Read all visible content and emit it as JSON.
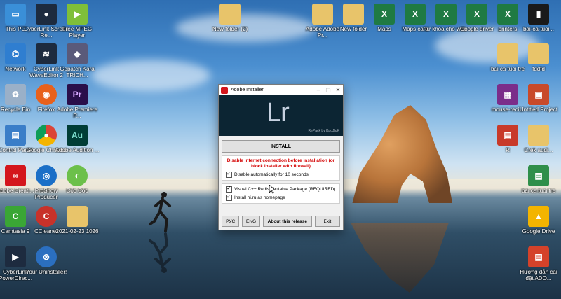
{
  "desktop_icons": [
    {
      "label": "This PC",
      "icon": "computer-icon",
      "color": "#3a8fd8"
    },
    {
      "label": "CyberLink Screen Re...",
      "icon": "screen-recorder-icon",
      "color": "#1d2b3f"
    },
    {
      "label": "Free MPEG Player",
      "icon": "media-player-icon",
      "color": "#7fbf3a"
    },
    {
      "label": "Network",
      "icon": "network-icon",
      "color": "#2f7ed0"
    },
    {
      "label": "CyberLink WaveEditor 2",
      "icon": "wave-editor-icon",
      "color": "#1d2b3f"
    },
    {
      "label": "Gepatch Kara TRICH...",
      "icon": "gepatch-icon",
      "color": "#5a5a7a"
    },
    {
      "label": "Recycle Bin",
      "icon": "recycle-bin-icon",
      "color": "#9ab0c8"
    },
    {
      "label": "Firefox",
      "icon": "firefox-icon",
      "color": "#e8611c"
    },
    {
      "label": "Adobe Premiere P...",
      "icon": "premiere-icon",
      "color": "#2a0f4a"
    },
    {
      "label": "Control Panel",
      "icon": "control-panel-icon",
      "color": "#3a7ec8"
    },
    {
      "label": "Google Chrome",
      "icon": "chrome-icon",
      "color": "#db4437"
    },
    {
      "label": "Adobe Audition ...",
      "icon": "audition-icon",
      "color": "#003d36"
    },
    {
      "label": "Adobe Creati...",
      "icon": "creative-cloud-icon",
      "color": "#d4161c"
    },
    {
      "label": "ProShow Producer",
      "icon": "proshow-icon",
      "color": "#1b6fc7"
    },
    {
      "label": "Cốc Cốc",
      "icon": "coccoc-icon",
      "color": "#6cc04a"
    },
    {
      "label": "Camtasia 9",
      "icon": "camtasia-icon",
      "color": "#3aa635"
    },
    {
      "label": "CCleaner",
      "icon": "ccleaner-icon",
      "color": "#c8322a"
    },
    {
      "label": "2021-02-23 1026",
      "icon": "folder-icon",
      "color": "#e8c46a"
    },
    {
      "label": "CyberLink PowerDirec...",
      "icon": "powerdirector-icon",
      "color": "#1d2b3f"
    },
    {
      "label": "Your Uninstaller!",
      "icon": "uninstaller-icon",
      "color": "#2b6fc0"
    },
    {
      "label": "New folder (2)",
      "icon": "folder-icon",
      "color": "#e8c46a"
    },
    {
      "label": "Adobe Adobe Pr...",
      "icon": "folder-icon",
      "color": "#e8c46a"
    },
    {
      "label": "New folder",
      "icon": "folder-icon",
      "color": "#e8c46a"
    },
    {
      "label": "Maps",
      "icon": "excel-icon",
      "color": "#1f7a43"
    },
    {
      "label": "Maps cafe",
      "icon": "excel-icon",
      "color": "#1f7a43"
    },
    {
      "label": "từ khóa cho web",
      "icon": "excel-icon",
      "color": "#1f7a43"
    },
    {
      "label": "Google driver",
      "icon": "excel-icon",
      "color": "#1f7a43"
    },
    {
      "label": "printers",
      "icon": "excel-icon",
      "color": "#1f7a43"
    },
    {
      "label": "bai-ca-tuoi...",
      "icon": "file-icon",
      "color": "#1a1a1a"
    },
    {
      "label": "bai ca tuoi tre",
      "icon": "folder-icon",
      "color": "#e8c46a"
    },
    {
      "label": "fddfd",
      "icon": "folder-icon",
      "color": "#e8c46a"
    },
    {
      "label": "mouse-reci...",
      "icon": "winrar-icon",
      "color": "#7b2d8a"
    },
    {
      "label": "Untitled Project",
      "icon": "project-icon",
      "color": "#c84a2a"
    },
    {
      "label": "R",
      "icon": "file-icon",
      "color": "#c83a2a"
    },
    {
      "label": "Crek audi...",
      "icon": "folder-icon",
      "color": "#e8c46a"
    },
    {
      "label": "bai ca tuoi tre",
      "icon": "document-icon",
      "color": "#2f8f4a"
    },
    {
      "label": "Google Drive",
      "icon": "google-drive-icon",
      "color": "#f3b400"
    },
    {
      "label": "Hướng dẫn cài đặt ADO...",
      "icon": "document-icon",
      "color": "#d4422a"
    }
  ],
  "installer": {
    "title": "Adobe Installer",
    "logo_text": "Lr",
    "repack_text": "RePack by KpoJIuK",
    "install_label": "INSTALL",
    "warning_text": "Disable Internet connection before installation (or block installer with firewall)",
    "check_disable_label": "Disable automatically for 10 seconds",
    "check_vcpp_label": "Visual C++ Redistributable Package (REQUIRED)",
    "check_hiru_label": "Install hi.ru as homepage",
    "rus_label": "РУС",
    "eng_label": "ENG",
    "about_label": "About this release",
    "exit_label": "Exit",
    "accent": "#d4161c",
    "banner_color": "#0c2533"
  }
}
